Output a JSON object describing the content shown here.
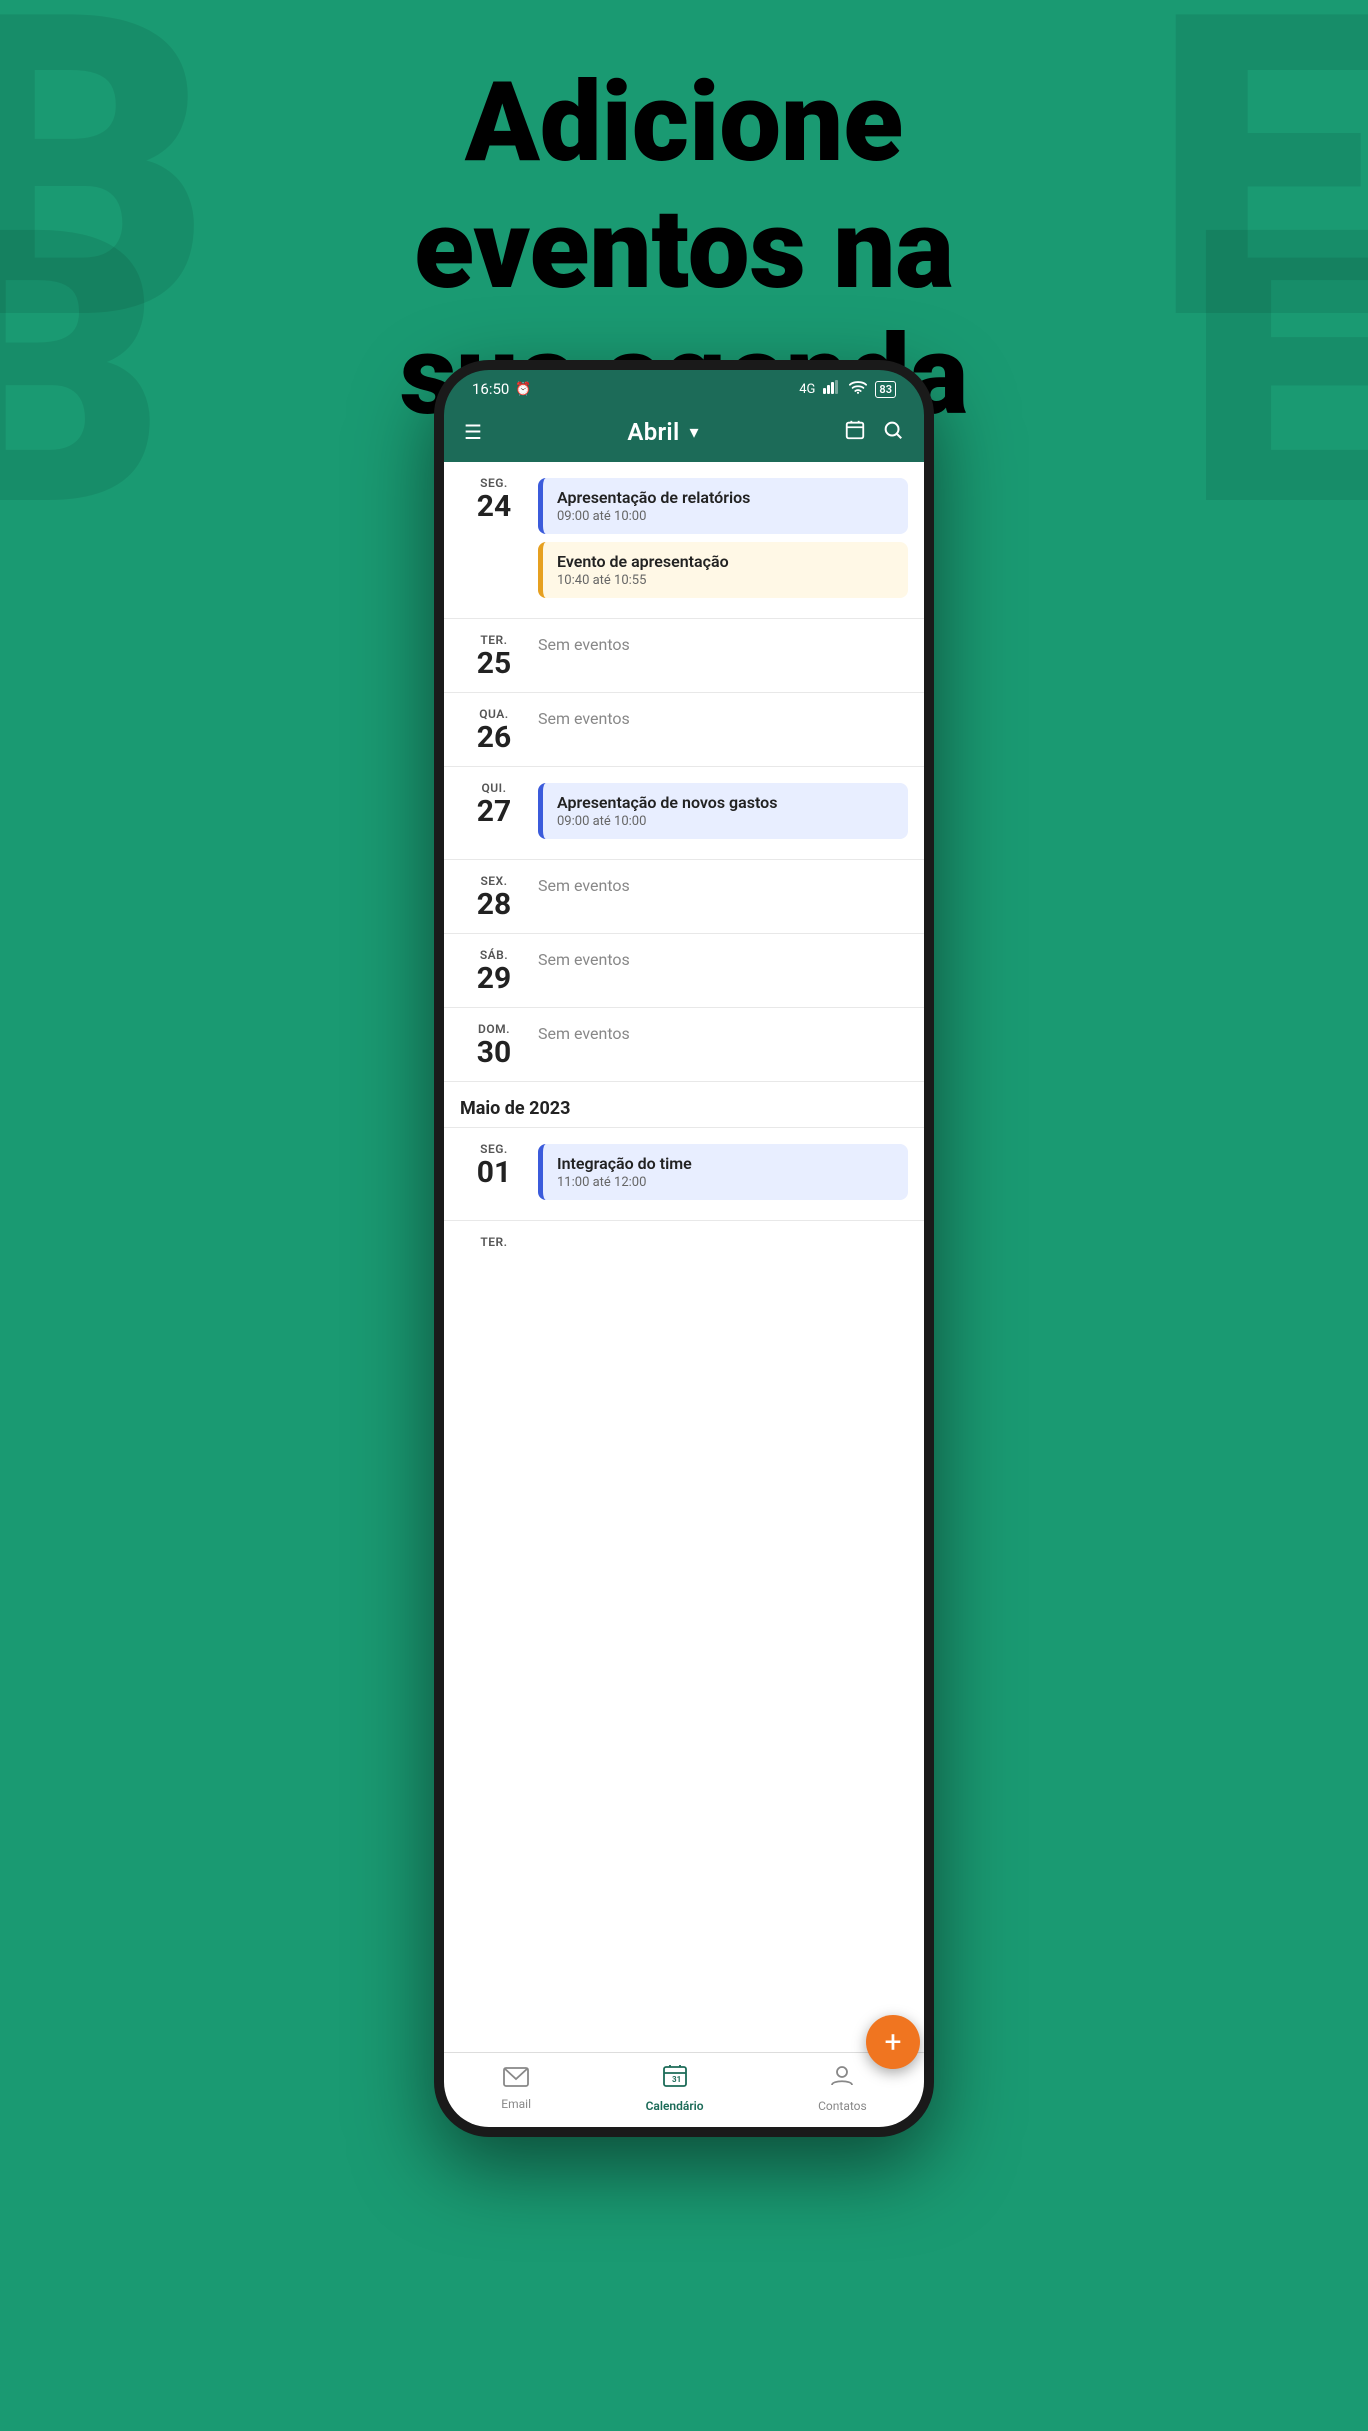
{
  "headline": {
    "line1": "Adicione",
    "line2": "eventos na",
    "line3": "sua agenda"
  },
  "status_bar": {
    "time": "16:50",
    "signal": "4G",
    "battery": "83"
  },
  "header": {
    "title": "Abril",
    "hamburger": "☰",
    "dropdown": "▾",
    "calendar_icon": "📅",
    "search_icon": "🔍"
  },
  "days": [
    {
      "day_name": "SEG.",
      "day_num": "24",
      "events": [
        {
          "type": "blue",
          "title": "Apresentação de relatórios",
          "time": "09:00 até 10:00"
        },
        {
          "type": "orange",
          "title": "Evento de apresentação",
          "time": "10:40 até 10:55"
        }
      ]
    },
    {
      "day_name": "TER.",
      "day_num": "25",
      "events": [],
      "no_events_label": "Sem eventos"
    },
    {
      "day_name": "QUA.",
      "day_num": "26",
      "events": [],
      "no_events_label": "Sem eventos"
    },
    {
      "day_name": "QUI.",
      "day_num": "27",
      "events": [
        {
          "type": "blue",
          "title": "Apresentação de novos gastos",
          "time": "09:00 até 10:00"
        }
      ]
    },
    {
      "day_name": "SEX.",
      "day_num": "28",
      "events": [],
      "no_events_label": "Sem eventos"
    },
    {
      "day_name": "SÁB.",
      "day_num": "29",
      "events": [],
      "no_events_label": "Sem eventos"
    },
    {
      "day_name": "DOM.",
      "day_num": "30",
      "events": [],
      "no_events_label": "Sem eventos"
    }
  ],
  "month_header": "Maio de 2023",
  "may_days": [
    {
      "day_name": "SEG.",
      "day_num": "01",
      "events": [
        {
          "type": "blue",
          "title": "Integração do time",
          "time": "11:00 até 12:00"
        }
      ]
    },
    {
      "day_name": "TER.",
      "day_num": "",
      "events": []
    }
  ],
  "fab_label": "+",
  "bottom_nav": {
    "email_label": "Email",
    "calendar_label": "Calendário",
    "contacts_label": "Contatos"
  }
}
